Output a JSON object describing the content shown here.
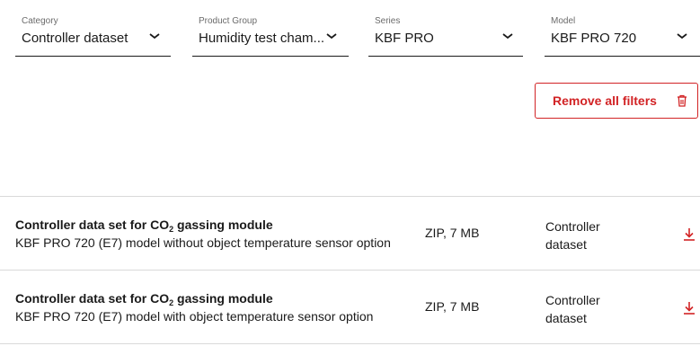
{
  "filters": [
    {
      "label": "Category",
      "value": "Controller dataset"
    },
    {
      "label": "Product Group",
      "value": "Humidity test cham..."
    },
    {
      "label": "Series",
      "value": "KBF PRO"
    },
    {
      "label": "Model",
      "value": "KBF PRO 720"
    }
  ],
  "remove_filters": {
    "label": "Remove all filters",
    "icon": "trash-icon"
  },
  "colors": {
    "accent": "#d22325",
    "divider": "#d9d9d9",
    "text": "#1a1a1a",
    "muted": "#6b6b6b"
  },
  "downloads": [
    {
      "title_pre": "Controller data set for CO",
      "title_sub": "2",
      "title_post": " gassing module",
      "description": "KBF PRO 720 (E7) model without object temperature sensor option",
      "size": "ZIP, 7 MB",
      "type": "Controller dataset",
      "icon": "download-icon"
    },
    {
      "title_pre": "Controller data set for CO",
      "title_sub": "2",
      "title_post": " gassing module",
      "description": "KBF PRO 720 (E7) model with object temperature sensor option",
      "size": "ZIP, 7 MB",
      "type": "Controller dataset",
      "icon": "download-icon"
    }
  ]
}
